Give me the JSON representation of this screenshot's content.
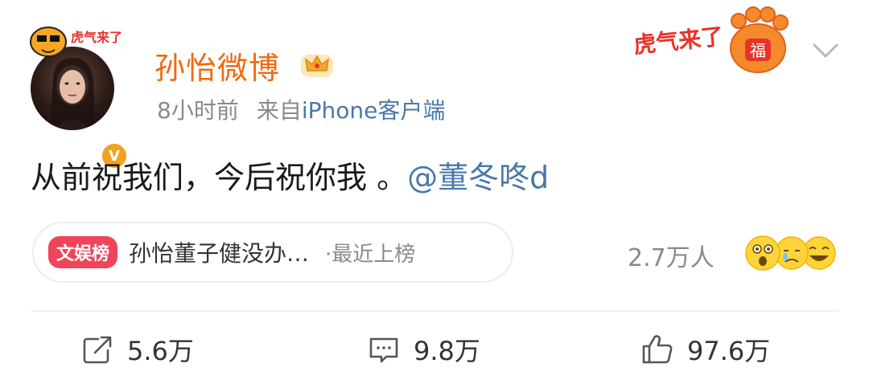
{
  "user": {
    "name": "孙怡微博",
    "time": "8小时前",
    "source_prefix": "来自",
    "source_client": "iPhone客户端",
    "verified_label": "V",
    "frame_text": "虎气来了"
  },
  "sticker": {
    "text": "虎气来了",
    "badge": "福"
  },
  "post": {
    "text": "从前祝我们，今后祝你我 。",
    "mention": "@董冬咚d"
  },
  "hot_tag": {
    "badge": "文娱榜",
    "title": "孙怡董子健没办…",
    "subtitle": "·最近上榜"
  },
  "reactions": {
    "count": "2.7万人",
    "icons": [
      "shocked-emoji-icon",
      "crying-emoji-icon",
      "laughing-emoji-icon"
    ]
  },
  "actions": {
    "repost": "5.6万",
    "comment": "9.8万",
    "like": "97.6万"
  },
  "colors": {
    "username": "#f06a0f",
    "link": "#4a78a8",
    "hot_badge": "#f0445b",
    "meta": "#8a8a8a"
  }
}
